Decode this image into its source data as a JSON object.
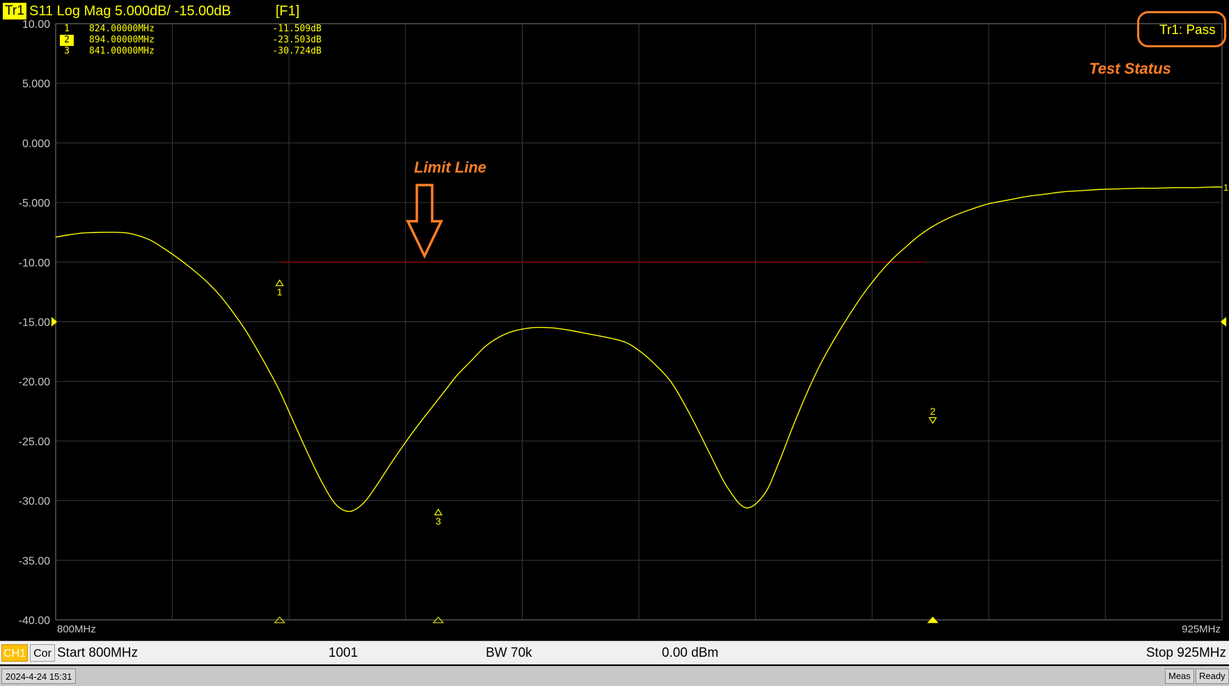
{
  "trace": {
    "id": "Tr1",
    "title": "S11 Log Mag 5.000dB/ -15.00dB",
    "function_key": "[F1]"
  },
  "markers": [
    {
      "num": "1",
      "freq": "824.00000MHz",
      "value": "-11.509dB",
      "active": false,
      "x": 824,
      "y": -11.509,
      "style": "open"
    },
    {
      "num": "2",
      "freq": "894.00000MHz",
      "value": "-23.503dB",
      "active": true,
      "x": 894,
      "y": -23.503,
      "style": "open"
    },
    {
      "num": "3",
      "freq": "841.00000MHz",
      "value": "-30.724dB",
      "active": false,
      "x": 841,
      "y": -30.724,
      "style": "open"
    }
  ],
  "test_status": {
    "value": "Tr1: Pass",
    "label": "Test Status"
  },
  "annotations": {
    "limit_line_label": "Limit Line"
  },
  "channel": {
    "ch_badge": "CH1",
    "cor_badge": "Cor",
    "start": "Start 800MHz",
    "points": "1001",
    "bw": "BW 70k",
    "power": "0.00 dBm",
    "stop": "Stop 925MHz"
  },
  "status_bar": {
    "datetime": "2024-4-24 15:31",
    "meas_label": "Meas",
    "ready_label": "Ready"
  },
  "colors": {
    "trace": "#ffff00",
    "grid": "#3a3a3a",
    "limit": "#b00000",
    "annotation": "#ff7f27",
    "background": "#000000",
    "axis_text": "#c8c8c8"
  },
  "chart_data": {
    "type": "line",
    "title": "S11 Log Mag 5.000dB/ -15.00dB",
    "xlabel": "",
    "ylabel": "",
    "xlim": [
      800,
      925
    ],
    "ylim": [
      -40,
      10
    ],
    "x_tick_labels": [
      "800MHz",
      "925MHz"
    ],
    "y_ticks": [
      10,
      5,
      0,
      -5,
      -10,
      -15,
      -20,
      -25,
      -30,
      -35,
      -40
    ],
    "y_tick_labels": [
      "10.00",
      "5.000",
      "0.000",
      "-5.000",
      "-10.00",
      "-15.00",
      "-20.00",
      "-25.00",
      "-30.00",
      "-35.00",
      "-40.00"
    ],
    "reference_level": -15,
    "grid": true,
    "x_divisions": 10,
    "series": [
      {
        "x": [
          800,
          801.5,
          803,
          805,
          806.5,
          808,
          810,
          811.5,
          813,
          814.5,
          816,
          817.5,
          819,
          820.5,
          822,
          823,
          824,
          825.5,
          827,
          828.5,
          830,
          831.5,
          833,
          834.5,
          836,
          837.5,
          839,
          840,
          840.5,
          841,
          841.5,
          842,
          843,
          844.5,
          846,
          847.5,
          849,
          851,
          853,
          855,
          857,
          859,
          861,
          862.5,
          864,
          866,
          868,
          870,
          872,
          874,
          876,
          877.5,
          879,
          880.5,
          882,
          883.5,
          885,
          886,
          887,
          887.5,
          888,
          889,
          890,
          891,
          892.5,
          894,
          896,
          898,
          900,
          902,
          904,
          906,
          908,
          910,
          912,
          914,
          916,
          918,
          920,
          922,
          924,
          925
        ],
        "y": [
          -7.9,
          -7.7,
          -7.55,
          -7.5,
          -7.5,
          -7.6,
          -8.1,
          -8.8,
          -9.6,
          -10.5,
          -11.5,
          -12.7,
          -14.2,
          -15.9,
          -17.9,
          -19.3,
          -20.8,
          -23.4,
          -26.0,
          -28.4,
          -30.3,
          -30.9,
          -30.2,
          -28.6,
          -26.8,
          -25.1,
          -23.5,
          -22.5,
          -22.0,
          -21.5,
          -21.0,
          -20.5,
          -19.5,
          -18.3,
          -17.1,
          -16.3,
          -15.8,
          -15.5,
          -15.5,
          -15.7,
          -16.0,
          -16.3,
          -16.7,
          -17.4,
          -18.4,
          -20.1,
          -22.8,
          -25.9,
          -28.9,
          -30.6,
          -29.4,
          -26.8,
          -23.8,
          -21.0,
          -18.5,
          -16.4,
          -14.5,
          -13.3,
          -12.2,
          -11.7,
          -11.2,
          -10.3,
          -9.5,
          -8.8,
          -7.8,
          -7.0,
          -6.2,
          -5.6,
          -5.1,
          -4.8,
          -4.5,
          -4.3,
          -4.1,
          -4.0,
          -3.9,
          -3.85,
          -3.8,
          -3.8,
          -3.75,
          -3.75,
          -3.7,
          -3.7
        ]
      }
    ],
    "limit_line": {
      "x": [
        824,
        893
      ],
      "y": [
        -10,
        -10
      ]
    },
    "stimulus_marks": [
      824,
      841,
      894
    ]
  }
}
